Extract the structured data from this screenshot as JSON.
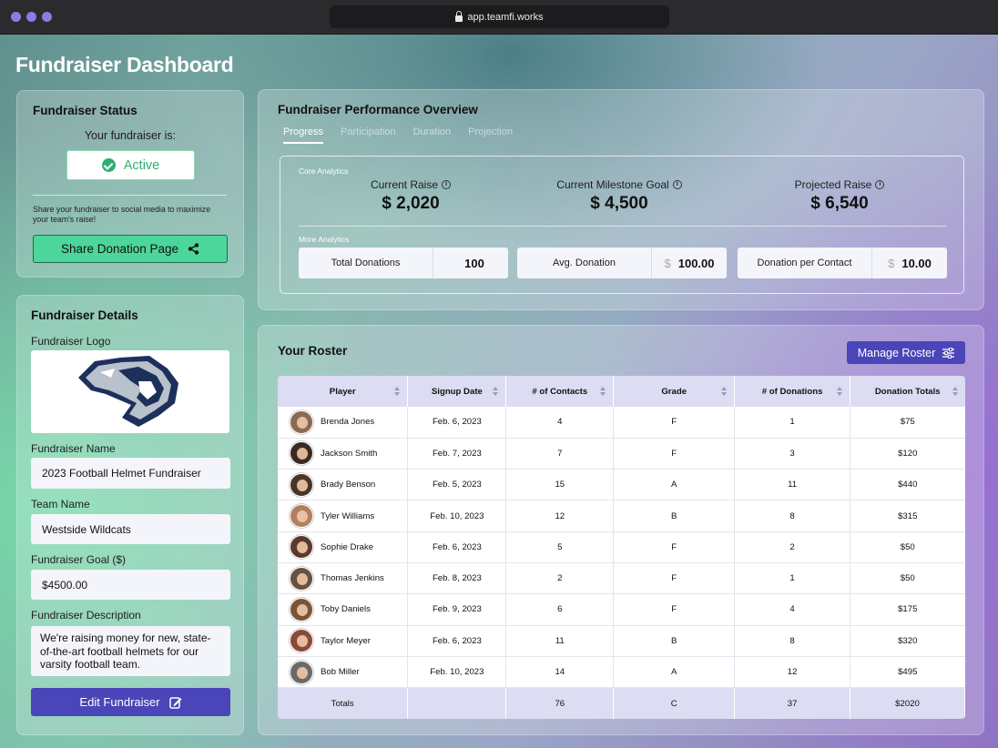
{
  "browser": {
    "url": "app.teamfi.works"
  },
  "page": {
    "title": "Fundraiser Dashboard"
  },
  "status": {
    "title": "Fundraiser Status",
    "prompt": "Your fundraiser is:",
    "state": "Active",
    "share_note": "Share your fundraiser to social media to maximize your team's raise!",
    "share_button": "Share Donation Page"
  },
  "details": {
    "title": "Fundraiser Details",
    "logo_label": "Fundraiser Logo",
    "name_label": "Fundraiser Name",
    "name_value": "2023 Football Helmet Fundraiser",
    "team_label": "Team Name",
    "team_value": "Westside Wildcats",
    "goal_label": "Fundraiser Goal ($)",
    "goal_value": "$4500.00",
    "desc_label": "Fundraiser Description",
    "desc_value": "We're raising money for new, state-of-the-art football helmets for our varsity football team.",
    "edit_button": "Edit Fundraiser"
  },
  "performance": {
    "title": "Fundraiser Performance Overview",
    "tabs": [
      "Progress",
      "Participation",
      "Duration",
      "Projection"
    ],
    "core_caption": "Core Analytics",
    "more_caption": "More Analytics",
    "metrics": [
      {
        "label": "Current Raise",
        "value": "$ 2,020"
      },
      {
        "label": "Current Milestone Goal",
        "value": "$ 4,500"
      },
      {
        "label": "Projected Raise",
        "value": "$ 6,540"
      }
    ],
    "stats": [
      {
        "label": "Total Donations",
        "currency": "",
        "value": "100"
      },
      {
        "label": "Avg. Donation",
        "currency": "$",
        "value": "100.00"
      },
      {
        "label": "Donation per Contact",
        "currency": "$",
        "value": "10.00"
      }
    ]
  },
  "roster": {
    "title": "Your Roster",
    "manage_button": "Manage Roster",
    "columns": [
      "Player",
      "Signup Date",
      "# of Contacts",
      "Grade",
      "# of Donations",
      "Donation Totals"
    ],
    "rows": [
      [
        "Brenda Jones",
        "Feb. 6, 2023",
        "4",
        "F",
        "1",
        "$75"
      ],
      [
        "Jackson Smith",
        "Feb. 7, 2023",
        "7",
        "F",
        "3",
        "$120"
      ],
      [
        "Brady Benson",
        "Feb. 5, 2023",
        "15",
        "A",
        "11",
        "$440"
      ],
      [
        "Tyler Williams",
        "Feb. 10, 2023",
        "12",
        "B",
        "8",
        "$315"
      ],
      [
        "Sophie Drake",
        "Feb. 6, 2023",
        "5",
        "F",
        "2",
        "$50"
      ],
      [
        "Thomas Jenkins",
        "Feb. 8, 2023",
        "2",
        "F",
        "1",
        "$50"
      ],
      [
        "Toby Daniels",
        "Feb. 9, 2023",
        "6",
        "F",
        "4",
        "$175"
      ],
      [
        "Taylor Meyer",
        "Feb. 6, 2023",
        "11",
        "B",
        "8",
        "$320"
      ],
      [
        "Bob Miller",
        "Feb. 10, 2023",
        "14",
        "A",
        "12",
        "$495"
      ]
    ],
    "avatar_colors": [
      "#8a6a55",
      "#3a2a22",
      "#4a3526",
      "#b08060",
      "#5a3a2a",
      "#6a5040",
      "#7a5535",
      "#8a4a3a",
      "#6a6a6a"
    ],
    "totals": [
      "Totals",
      "",
      "76",
      "C",
      "37",
      "$2020"
    ]
  },
  "colors": {
    "accent": "#4a45b8",
    "active": "#2fae74",
    "share": "#4dd69b",
    "table_header": "#dcdcf2"
  }
}
